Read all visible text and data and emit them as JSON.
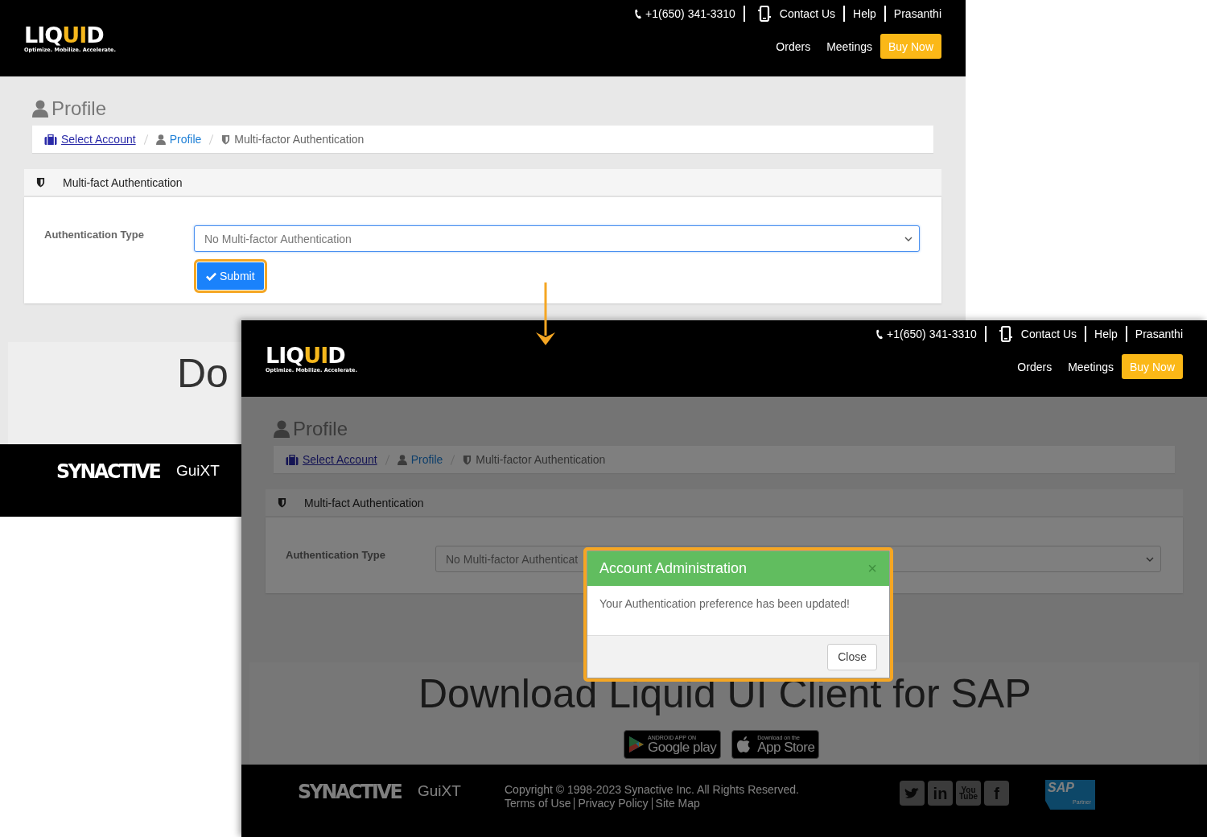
{
  "screens": [
    {
      "kind": "before",
      "header": {
        "logo": {
          "parts": [
            {
              "text": "LIQ",
              "accent": false
            },
            {
              "text": "UI",
              "accent": true
            },
            {
              "text": "D",
              "accent": false
            }
          ],
          "tagline": "Optimize. Mobilize. Accelerate."
        },
        "top_links": [
          {
            "kind": "phone",
            "label": "+1(650) 341-3310"
          },
          {
            "kind": "contact",
            "label": "Contact Us"
          },
          {
            "kind": "plain",
            "label": "Help"
          },
          {
            "kind": "plain",
            "label": "Prasanthi"
          }
        ],
        "nav": [
          {
            "kind": "link",
            "label": "Orders"
          },
          {
            "kind": "link",
            "label": "Meetings"
          },
          {
            "kind": "button",
            "label": "Buy Now"
          }
        ]
      },
      "page_title": "Profile",
      "breadcrumb": [
        {
          "kind": "account",
          "label": "Select Account"
        },
        {
          "kind": "profile",
          "label": "Profile"
        },
        {
          "kind": "current",
          "label": "Multi-factor Authentication"
        }
      ],
      "panel": {
        "title": "Multi-fact Authentication",
        "field_label": "Authentication Type",
        "select_value": "No Multi-factor Authentication",
        "focused": true,
        "submit": {
          "label": "Submit",
          "highlighted": true
        }
      },
      "download": {
        "title": "Do"
      },
      "footer": {
        "logo": {
          "brand": "SYNACTIVE",
          "product": "GuiXT"
        }
      }
    },
    {
      "kind": "after",
      "header": {
        "logo": {
          "parts": [
            {
              "text": "LIQ",
              "accent": false
            },
            {
              "text": "UI",
              "accent": true
            },
            {
              "text": "D",
              "accent": false
            }
          ],
          "tagline": "Optimize. Mobilize. Accelerate."
        },
        "top_links": [
          {
            "kind": "phone",
            "label": "+1(650) 341-3310"
          },
          {
            "kind": "contact",
            "label": "Contact Us"
          },
          {
            "kind": "plain",
            "label": "Help"
          },
          {
            "kind": "plain",
            "label": "Prasanthi"
          }
        ],
        "nav": [
          {
            "kind": "link",
            "label": "Orders"
          },
          {
            "kind": "link",
            "label": "Meetings"
          },
          {
            "kind": "button",
            "label": "Buy Now"
          }
        ]
      },
      "page_title": "Profile",
      "breadcrumb": [
        {
          "kind": "account",
          "label": "Select Account"
        },
        {
          "kind": "profile",
          "label": "Profile"
        },
        {
          "kind": "current",
          "label": "Multi-factor Authentication"
        }
      ],
      "panel": {
        "title": "Multi-fact Authentication",
        "field_label": "Authentication Type",
        "select_value": "No Multi-factor Authenticat",
        "focused": false
      },
      "download": {
        "title": "Download Liquid UI Client for SAP",
        "badges": [
          {
            "kind": "google",
            "small": "ANDROID APP ON",
            "big": "Google play"
          },
          {
            "kind": "apple",
            "small": "Download on the",
            "big": "App Store"
          }
        ]
      },
      "footer": {
        "logo": {
          "brand": "SYNACTIVE",
          "product": "GuiXT"
        },
        "copyright": "Copyright © 1998-2023 Synactive Inc. All Rights Reserved.",
        "links": [
          "Terms of Use",
          "Privacy Policy",
          "Site Map"
        ],
        "social": [
          {
            "kind": "bird"
          },
          {
            "kind": "letters",
            "label": "in"
          },
          {
            "kind": "letters",
            "label": "You Tube"
          },
          {
            "kind": "letters",
            "label": "f"
          }
        ],
        "partner_logo": {
          "brand": "SAP",
          "label": "Partner"
        }
      },
      "dimmed": true,
      "modal": {
        "title": "Account Administration",
        "close": "×",
        "message": "Your Authentication preference has been updated!",
        "button": "Close",
        "highlighted": true
      }
    }
  ]
}
